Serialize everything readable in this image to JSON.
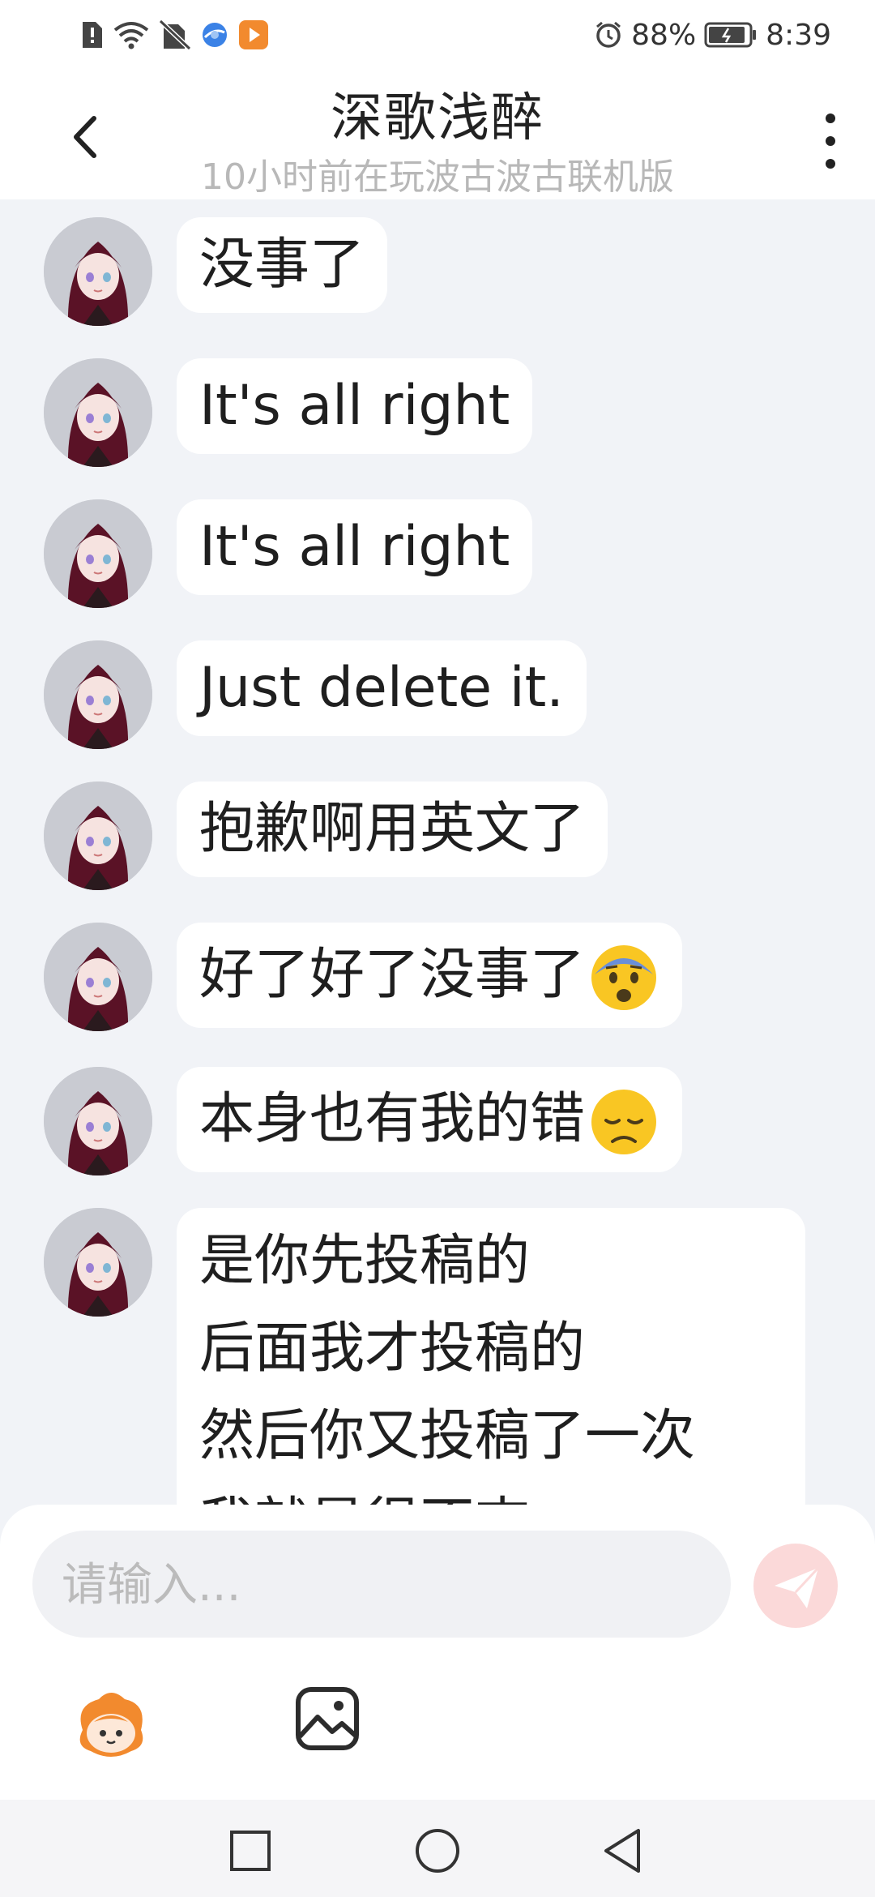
{
  "status_bar": {
    "battery": "88%",
    "time": "8:39",
    "icons": [
      "sim-alert-icon",
      "wifi-icon",
      "no-sim-icon",
      "browser-icon",
      "video-app-icon",
      "alarm-icon",
      "battery-icon"
    ]
  },
  "header": {
    "title": "深歌浅醉",
    "subtitle": "10小时前在玩波古波古联机版",
    "icons": [
      "back-arrow-icon",
      "more-vertical-icon"
    ]
  },
  "messages": [
    {
      "text": "没事了"
    },
    {
      "text": "It's all right"
    },
    {
      "text": "It's all right"
    },
    {
      "text": "Just delete it."
    },
    {
      "text": "抱歉啊用英文了"
    },
    {
      "text": "好了好了没事了",
      "emoji": "fearful-face-emoji"
    },
    {
      "text": "本身也有我的错",
      "emoji": "disappointed-face-emoji"
    },
    {
      "lines": [
        "是你先投稿的",
        "后面我才投稿的",
        "然后你又投稿了一次",
        "我就是很不爽"
      ]
    }
  ],
  "input": {
    "placeholder": "请输入...",
    "value": ""
  },
  "toolbar": {
    "icons": [
      "sticker-icon",
      "image-icon",
      "send-icon"
    ]
  },
  "nav_bar": {
    "icons": [
      "recent-apps-icon",
      "home-icon",
      "back-nav-icon"
    ]
  },
  "colors": {
    "chat_background": "#f1f3f7",
    "bubble": "#ffffff",
    "send_button": "#fbd9d9",
    "subtitle": "#b8b8b8"
  }
}
